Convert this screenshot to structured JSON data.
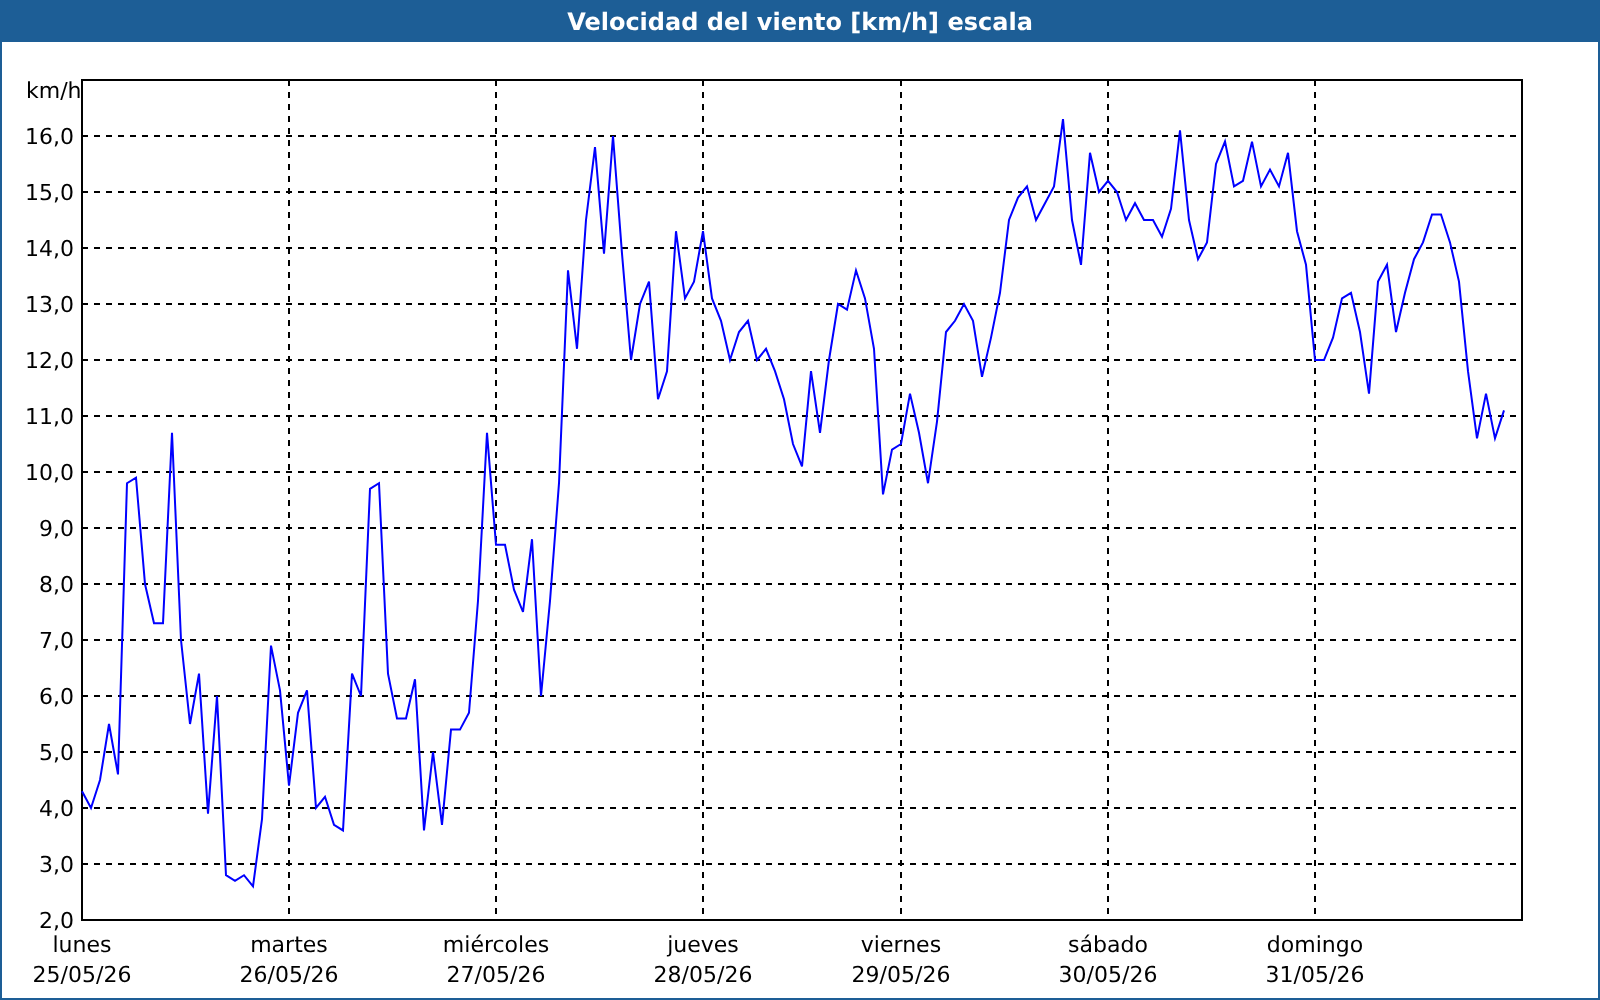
{
  "window": {
    "title": "Velocidad del viento [km/h] escala"
  },
  "chart": {
    "chart_data": {
      "type": "line",
      "ylabel": "km/h",
      "grid": true,
      "ylim": [
        2,
        17
      ],
      "yticks": [
        {
          "value": 2,
          "label": "2,0"
        },
        {
          "value": 3,
          "label": "3,0"
        },
        {
          "value": 4,
          "label": "4,0"
        },
        {
          "value": 5,
          "label": "5,0"
        },
        {
          "value": 6,
          "label": "6,0"
        },
        {
          "value": 7,
          "label": "7,0"
        },
        {
          "value": 8,
          "label": "8,0"
        },
        {
          "value": 9,
          "label": "9,0"
        },
        {
          "value": 10,
          "label": "10,0"
        },
        {
          "value": 11,
          "label": "11,0"
        },
        {
          "value": 12,
          "label": "12,0"
        },
        {
          "value": 13,
          "label": "13,0"
        },
        {
          "value": 14,
          "label": "14,0"
        },
        {
          "value": 15,
          "label": "15,0"
        },
        {
          "value": 16,
          "label": "16,0"
        }
      ],
      "categories": [
        "lunes\n25/05/26",
        null,
        null,
        null,
        null,
        null,
        null,
        null,
        null,
        null,
        null,
        null,
        null,
        null,
        null,
        null,
        null,
        null,
        null,
        null,
        null,
        null,
        null,
        "martes\n26/05/26",
        null,
        null,
        null,
        null,
        null,
        null,
        null,
        null,
        null,
        null,
        null,
        null,
        null,
        null,
        null,
        null,
        null,
        null,
        null,
        null,
        null,
        null,
        "miércoles\n27/05/26",
        null,
        null,
        null,
        null,
        null,
        null,
        null,
        null,
        null,
        null,
        null,
        null,
        null,
        null,
        null,
        null,
        null,
        null,
        null,
        null,
        null,
        null,
        "jueves\n28/05/26",
        null,
        null,
        null,
        null,
        null,
        null,
        null,
        null,
        null,
        null,
        null,
        null,
        null,
        null,
        null,
        null,
        null,
        null,
        null,
        null,
        null,
        "viernes\n29/05/26",
        null,
        null,
        null,
        null,
        null,
        null,
        null,
        null,
        null,
        null,
        null,
        null,
        null,
        null,
        null,
        null,
        null,
        null,
        null,
        null,
        null,
        null,
        "sábado\n30/05/26",
        null,
        null,
        null,
        null,
        null,
        null,
        null,
        null,
        null,
        null,
        null,
        null,
        null,
        null,
        null,
        null,
        null,
        null,
        null,
        null,
        null,
        null,
        "domingo\n31/05/26",
        null,
        null,
        null,
        null,
        null,
        null,
        null,
        null,
        null,
        null,
        null,
        null,
        null,
        null,
        null,
        null,
        null,
        null,
        null,
        null,
        null
      ],
      "series": [
        {
          "color": "#0000ff",
          "values": [
            4.3,
            4.0,
            4.5,
            5.5,
            4.6,
            9.8,
            9.9,
            8.0,
            7.3,
            7.3,
            10.7,
            7.0,
            5.5,
            6.4,
            3.9,
            6.0,
            2.8,
            2.7,
            2.8,
            2.6,
            3.8,
            6.9,
            6.1,
            4.4,
            5.7,
            6.1,
            4.0,
            4.2,
            3.7,
            3.6,
            6.4,
            6.0,
            9.7,
            9.8,
            6.4,
            5.6,
            5.6,
            6.3,
            3.6,
            5.0,
            3.7,
            5.4,
            5.4,
            5.7,
            7.7,
            10.7,
            8.7,
            8.7,
            7.9,
            7.5,
            8.8,
            6.0,
            7.7,
            9.8,
            13.6,
            12.2,
            14.5,
            15.8,
            13.9,
            16.0,
            13.9,
            12.0,
            13.0,
            13.4,
            11.3,
            11.8,
            14.3,
            13.1,
            13.4,
            14.3,
            13.1,
            12.7,
            12.0,
            12.5,
            12.7,
            12.0,
            12.2,
            11.8,
            11.3,
            10.5,
            10.1,
            11.8,
            10.7,
            12.0,
            13.0,
            12.9,
            13.6,
            13.1,
            12.2,
            9.6,
            10.4,
            10.5,
            11.4,
            10.7,
            9.8,
            10.9,
            12.5,
            12.7,
            13.0,
            12.7,
            11.7,
            12.4,
            13.2,
            14.5,
            14.9,
            15.1,
            14.5,
            14.8,
            15.1,
            16.3,
            14.5,
            13.7,
            15.7,
            15.0,
            15.2,
            15.0,
            14.5,
            14.8,
            14.5,
            14.5,
            14.2,
            14.7,
            16.1,
            14.5,
            13.8,
            14.1,
            15.5,
            15.9,
            15.1,
            15.2,
            15.9,
            15.1,
            15.4,
            15.1,
            15.7,
            14.3,
            13.7,
            12.0,
            12.0,
            12.4,
            13.1,
            13.2,
            12.5,
            11.4,
            13.4,
            13.7,
            12.5,
            13.2,
            13.8,
            14.1,
            14.6,
            14.6,
            14.1,
            13.4,
            11.8,
            10.6,
            11.4,
            10.6,
            11.1
          ]
        }
      ]
    }
  }
}
